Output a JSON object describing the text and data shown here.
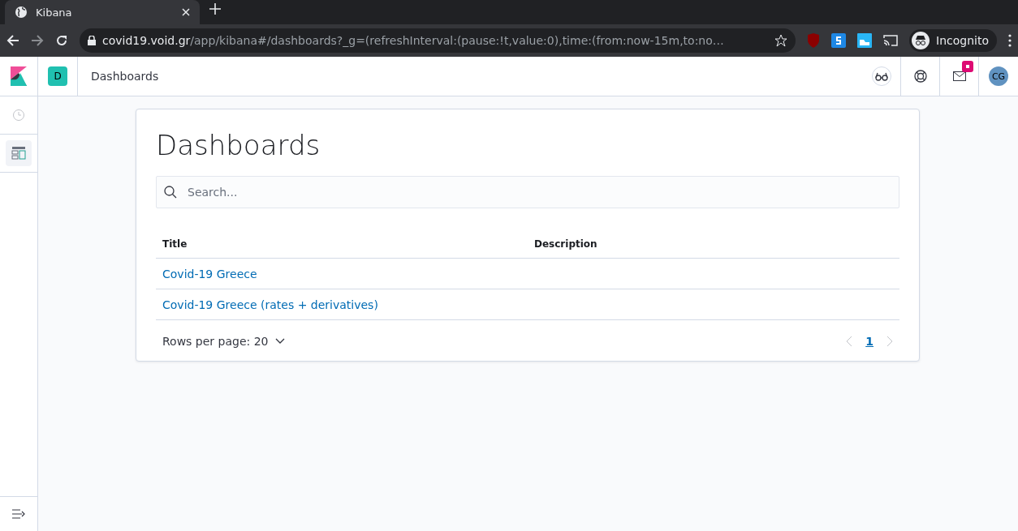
{
  "browser": {
    "tab_title": "Kibana",
    "url_host": "covid19.void.gr",
    "url_path": "/app/kibana#/dashboards?_g=(refreshInterval:(pause:!t,value:0),time:(from:now-15m,to:no…",
    "profile": "Incognito"
  },
  "header": {
    "space_initial": "D",
    "breadcrumb": "Dashboards",
    "user_initials": "CG",
    "news_badge": true
  },
  "sidebar": {
    "items": [
      {
        "kind": "recent",
        "selected": false
      },
      {
        "kind": "dashboard",
        "selected": true
      }
    ]
  },
  "page": {
    "title": "Dashboards",
    "search": {
      "placeholder": "Search..."
    },
    "table": {
      "columns": [
        "Title",
        "Description"
      ],
      "rows": [
        {
          "title": "Covid-19 Greece",
          "description": ""
        },
        {
          "title": "Covid-19 Greece (rates + derivatives)",
          "description": ""
        }
      ]
    },
    "rows_per_page": "Rows per page: 20",
    "pages": [
      {
        "label": "1",
        "selected": true
      }
    ]
  }
}
